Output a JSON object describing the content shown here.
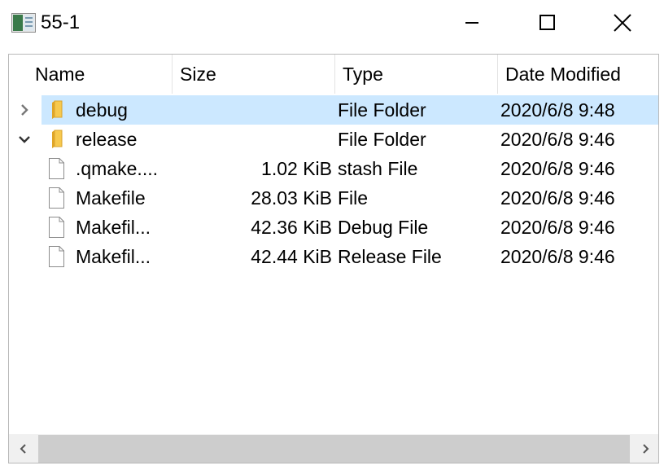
{
  "window": {
    "title": "55-1",
    "app_icon": "app-window-icon"
  },
  "controls": {
    "minimize_icon": "minimize-icon",
    "maximize_icon": "maximize-icon",
    "close_icon": "close-icon"
  },
  "columns": {
    "name": "Name",
    "size": "Size",
    "type": "Type",
    "date": "Date Modified"
  },
  "rows": [
    {
      "name": "debug",
      "size": "",
      "type": "File Folder",
      "date": "2020/6/8 9:48",
      "icon": "folder-icon",
      "expander": "collapsed",
      "selected": true
    },
    {
      "name": "release",
      "size": "",
      "type": "File Folder",
      "date": "2020/6/8 9:46",
      "icon": "folder-icon",
      "expander": "expanded",
      "selected": false
    },
    {
      "name": ".qmake....",
      "size": "1.02 KiB",
      "type": "stash File",
      "date": "2020/6/8 9:46",
      "icon": "file-icon",
      "expander": "none",
      "selected": false
    },
    {
      "name": "Makefile",
      "size": "28.03 KiB",
      "type": "File",
      "date": "2020/6/8 9:46",
      "icon": "file-icon",
      "expander": "none",
      "selected": false
    },
    {
      "name": "Makefil...",
      "size": "42.36 KiB",
      "type": "Debug File",
      "date": "2020/6/8 9:46",
      "icon": "file-icon",
      "expander": "none",
      "selected": false
    },
    {
      "name": "Makefil...",
      "size": "42.44 KiB",
      "type": "Release File",
      "date": "2020/6/8 9:46",
      "icon": "file-icon",
      "expander": "none",
      "selected": false
    }
  ],
  "colors": {
    "selection": "#cce8ff",
    "folder": "#f7c94e",
    "scrollbar_track": "#f0f0f0",
    "scrollbar_thumb": "#cdcdcd"
  }
}
